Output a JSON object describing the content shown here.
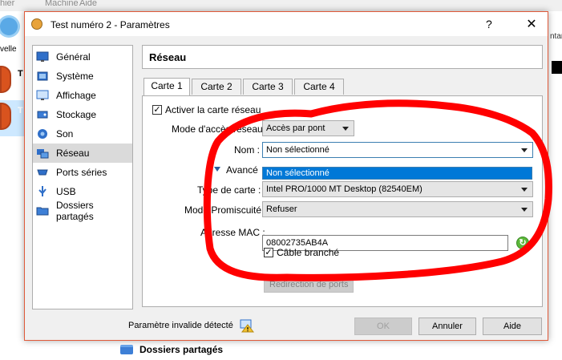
{
  "background": {
    "menu": [
      "hier",
      "Machine",
      "Aide"
    ],
    "new_label": "velle",
    "vm_letter": "T",
    "right_fragment": "ntar",
    "shared_folders": "Dossiers partagés"
  },
  "dialog": {
    "title": "Test numéro 2 - Paramètres",
    "help_glyph": "?",
    "close_glyph": "✕",
    "sidebar": [
      {
        "label": "Général",
        "icon": "monitor-icon"
      },
      {
        "label": "Système",
        "icon": "chip-icon"
      },
      {
        "label": "Affichage",
        "icon": "display-icon"
      },
      {
        "label": "Stockage",
        "icon": "storage-icon"
      },
      {
        "label": "Son",
        "icon": "speaker-icon"
      },
      {
        "label": "Réseau",
        "icon": "network-icon"
      },
      {
        "label": "Ports séries",
        "icon": "serial-port-icon"
      },
      {
        "label": "USB",
        "icon": "usb-icon"
      },
      {
        "label": "Dossiers partagés",
        "icon": "folder-icon"
      }
    ],
    "selected_section": "Réseau",
    "section_title": "Réseau",
    "tabs": [
      "Carte 1",
      "Carte 2",
      "Carte 3",
      "Carte 4"
    ],
    "active_tab": "Carte 1",
    "form": {
      "enable_label": "Activer la carte réseau",
      "enable_checked": true,
      "mode_label": "Mode d'accès réseau :",
      "mode_value": "Accès par pont",
      "name_label": "Nom :",
      "name_value": "Non sélectionné",
      "name_option": "Non sélectionné",
      "advanced_label": "Avancé",
      "adapter_label": "Type de carte :",
      "adapter_value": "Intel PRO/1000 MT Desktop (82540EM)",
      "promisc_label": "Mode Promiscuité :",
      "promisc_value": "Refuser",
      "mac_label": "Adresse MAC :",
      "mac_value": "08002735AB4A",
      "cable_label": "Câble branché",
      "cable_checked": true,
      "port_forward_label": "Redirection de ports"
    },
    "status_text": "Paramètre invalide détecté",
    "buttons": {
      "ok": "OK",
      "cancel": "Annuler",
      "help": "Aide"
    }
  },
  "colors": {
    "annotation": "#ff0000",
    "selection": "#0078d7",
    "sidebar_selected": "#dadada"
  }
}
